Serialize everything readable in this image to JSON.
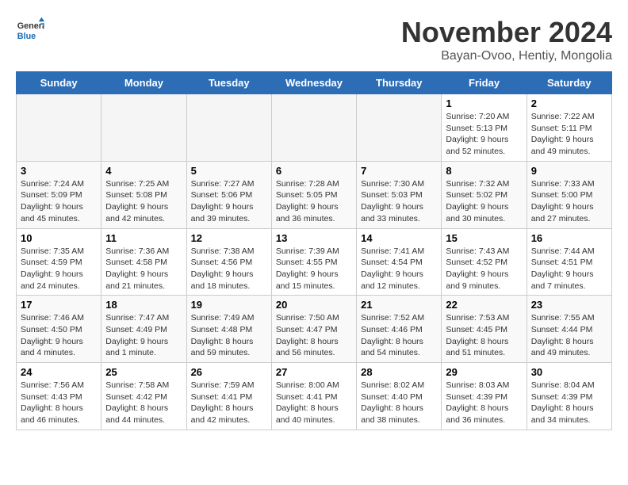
{
  "header": {
    "logo_general": "General",
    "logo_blue": "Blue",
    "title": "November 2024",
    "subtitle": "Bayan-Ovoo, Hentiy, Mongolia"
  },
  "calendar": {
    "days_of_week": [
      "Sunday",
      "Monday",
      "Tuesday",
      "Wednesday",
      "Thursday",
      "Friday",
      "Saturday"
    ],
    "weeks": [
      [
        {
          "day": "",
          "info": ""
        },
        {
          "day": "",
          "info": ""
        },
        {
          "day": "",
          "info": ""
        },
        {
          "day": "",
          "info": ""
        },
        {
          "day": "",
          "info": ""
        },
        {
          "day": "1",
          "info": "Sunrise: 7:20 AM\nSunset: 5:13 PM\nDaylight: 9 hours and 52 minutes."
        },
        {
          "day": "2",
          "info": "Sunrise: 7:22 AM\nSunset: 5:11 PM\nDaylight: 9 hours and 49 minutes."
        }
      ],
      [
        {
          "day": "3",
          "info": "Sunrise: 7:24 AM\nSunset: 5:09 PM\nDaylight: 9 hours and 45 minutes."
        },
        {
          "day": "4",
          "info": "Sunrise: 7:25 AM\nSunset: 5:08 PM\nDaylight: 9 hours and 42 minutes."
        },
        {
          "day": "5",
          "info": "Sunrise: 7:27 AM\nSunset: 5:06 PM\nDaylight: 9 hours and 39 minutes."
        },
        {
          "day": "6",
          "info": "Sunrise: 7:28 AM\nSunset: 5:05 PM\nDaylight: 9 hours and 36 minutes."
        },
        {
          "day": "7",
          "info": "Sunrise: 7:30 AM\nSunset: 5:03 PM\nDaylight: 9 hours and 33 minutes."
        },
        {
          "day": "8",
          "info": "Sunrise: 7:32 AM\nSunset: 5:02 PM\nDaylight: 9 hours and 30 minutes."
        },
        {
          "day": "9",
          "info": "Sunrise: 7:33 AM\nSunset: 5:00 PM\nDaylight: 9 hours and 27 minutes."
        }
      ],
      [
        {
          "day": "10",
          "info": "Sunrise: 7:35 AM\nSunset: 4:59 PM\nDaylight: 9 hours and 24 minutes."
        },
        {
          "day": "11",
          "info": "Sunrise: 7:36 AM\nSunset: 4:58 PM\nDaylight: 9 hours and 21 minutes."
        },
        {
          "day": "12",
          "info": "Sunrise: 7:38 AM\nSunset: 4:56 PM\nDaylight: 9 hours and 18 minutes."
        },
        {
          "day": "13",
          "info": "Sunrise: 7:39 AM\nSunset: 4:55 PM\nDaylight: 9 hours and 15 minutes."
        },
        {
          "day": "14",
          "info": "Sunrise: 7:41 AM\nSunset: 4:54 PM\nDaylight: 9 hours and 12 minutes."
        },
        {
          "day": "15",
          "info": "Sunrise: 7:43 AM\nSunset: 4:52 PM\nDaylight: 9 hours and 9 minutes."
        },
        {
          "day": "16",
          "info": "Sunrise: 7:44 AM\nSunset: 4:51 PM\nDaylight: 9 hours and 7 minutes."
        }
      ],
      [
        {
          "day": "17",
          "info": "Sunrise: 7:46 AM\nSunset: 4:50 PM\nDaylight: 9 hours and 4 minutes."
        },
        {
          "day": "18",
          "info": "Sunrise: 7:47 AM\nSunset: 4:49 PM\nDaylight: 9 hours and 1 minute."
        },
        {
          "day": "19",
          "info": "Sunrise: 7:49 AM\nSunset: 4:48 PM\nDaylight: 8 hours and 59 minutes."
        },
        {
          "day": "20",
          "info": "Sunrise: 7:50 AM\nSunset: 4:47 PM\nDaylight: 8 hours and 56 minutes."
        },
        {
          "day": "21",
          "info": "Sunrise: 7:52 AM\nSunset: 4:46 PM\nDaylight: 8 hours and 54 minutes."
        },
        {
          "day": "22",
          "info": "Sunrise: 7:53 AM\nSunset: 4:45 PM\nDaylight: 8 hours and 51 minutes."
        },
        {
          "day": "23",
          "info": "Sunrise: 7:55 AM\nSunset: 4:44 PM\nDaylight: 8 hours and 49 minutes."
        }
      ],
      [
        {
          "day": "24",
          "info": "Sunrise: 7:56 AM\nSunset: 4:43 PM\nDaylight: 8 hours and 46 minutes."
        },
        {
          "day": "25",
          "info": "Sunrise: 7:58 AM\nSunset: 4:42 PM\nDaylight: 8 hours and 44 minutes."
        },
        {
          "day": "26",
          "info": "Sunrise: 7:59 AM\nSunset: 4:41 PM\nDaylight: 8 hours and 42 minutes."
        },
        {
          "day": "27",
          "info": "Sunrise: 8:00 AM\nSunset: 4:41 PM\nDaylight: 8 hours and 40 minutes."
        },
        {
          "day": "28",
          "info": "Sunrise: 8:02 AM\nSunset: 4:40 PM\nDaylight: 8 hours and 38 minutes."
        },
        {
          "day": "29",
          "info": "Sunrise: 8:03 AM\nSunset: 4:39 PM\nDaylight: 8 hours and 36 minutes."
        },
        {
          "day": "30",
          "info": "Sunrise: 8:04 AM\nSunset: 4:39 PM\nDaylight: 8 hours and 34 minutes."
        }
      ]
    ]
  }
}
